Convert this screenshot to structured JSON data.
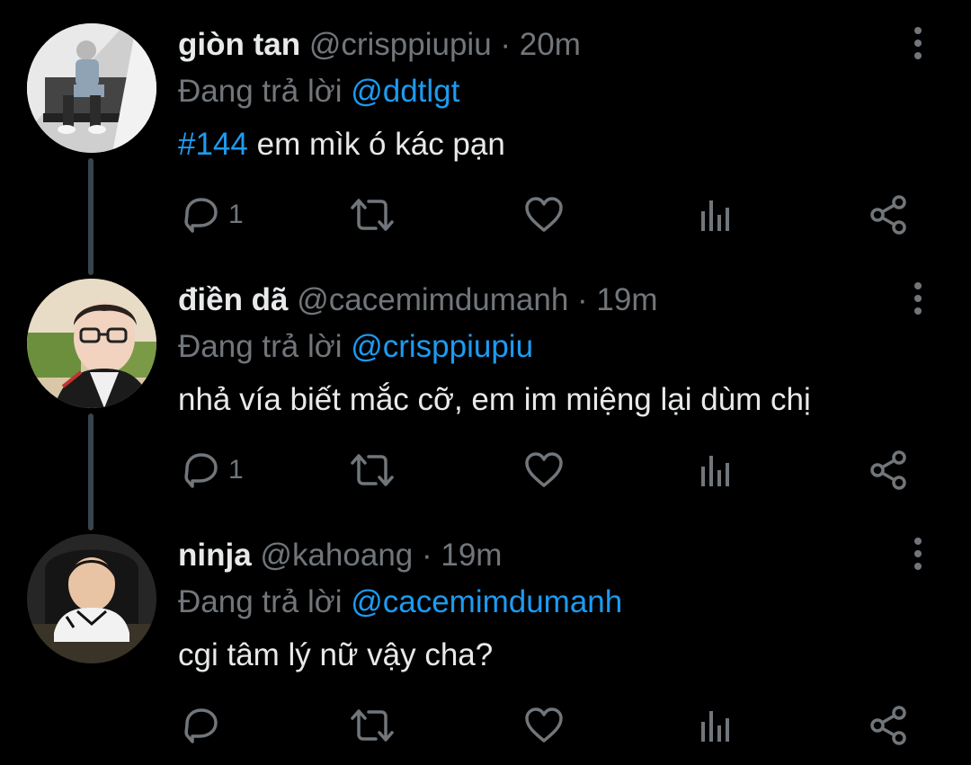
{
  "colors": {
    "background": "#000000",
    "primary_text": "#e7e9ea",
    "secondary_text": "#71767b",
    "accent": "#1d9bf0",
    "thread_line": "#38444d"
  },
  "tweets": [
    {
      "name": "giòn tan",
      "handle": "@crisppiupiu",
      "separator": "·",
      "time": "20m",
      "reply_prefix": "Đang trả lời",
      "reply_to": "@ddtlgt",
      "hashtag": "#144",
      "text": "em mìk ó kác pạn",
      "reply_count": "1",
      "avatar": "avatar-giontan"
    },
    {
      "name": "điền dã",
      "handle": "@cacemimdumanh",
      "separator": "·",
      "time": "19m",
      "reply_prefix": "Đang trả lời",
      "reply_to": "@crisppiupiu",
      "text": "nhả vía biết mắc cỡ, em im miệng lại dùm chị",
      "reply_count": "1",
      "avatar": "avatar-diemda"
    },
    {
      "name": "ninja",
      "handle": "@kahoang",
      "separator": "·",
      "time": "19m",
      "reply_prefix": "Đang trả lời",
      "reply_to": "@cacemimdumanh",
      "text": "cgi tâm lý nữ vậy cha?",
      "reply_count": "",
      "avatar": "avatar-ninja"
    }
  ],
  "icons": {
    "reply": "reply-icon",
    "retweet": "retweet-icon",
    "like": "heart-icon",
    "analytics": "analytics-icon",
    "share": "share-icon",
    "more": "more-vertical-icon"
  }
}
